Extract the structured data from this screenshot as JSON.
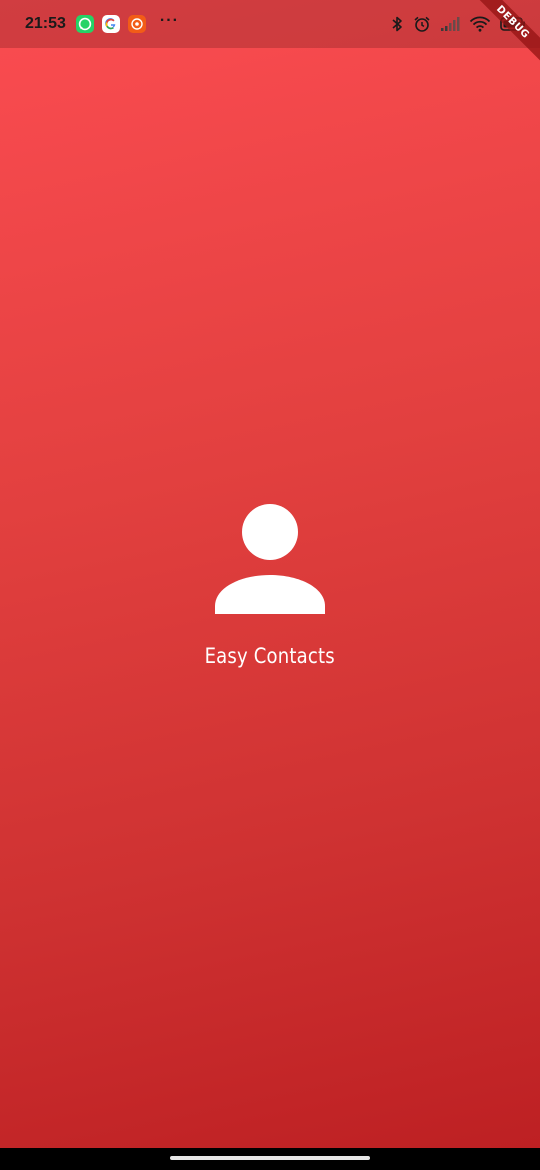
{
  "status_bar": {
    "time": "21:53",
    "more_indicator": "···",
    "notification_icons": [
      "whatsapp-icon",
      "google-icon",
      "app-notification-icon"
    ],
    "system_icons": [
      "bluetooth-icon",
      "alarm-icon",
      "signal-icon",
      "wifi-icon",
      "battery-icon"
    ]
  },
  "debug_banner": {
    "label": "DEBUG"
  },
  "splash": {
    "icon": "person-icon",
    "title": "Easy Contacts"
  },
  "colors": {
    "gradient_top": "#fb4c51",
    "gradient_bottom": "#bc1f22",
    "foreground": "#ffffff"
  }
}
